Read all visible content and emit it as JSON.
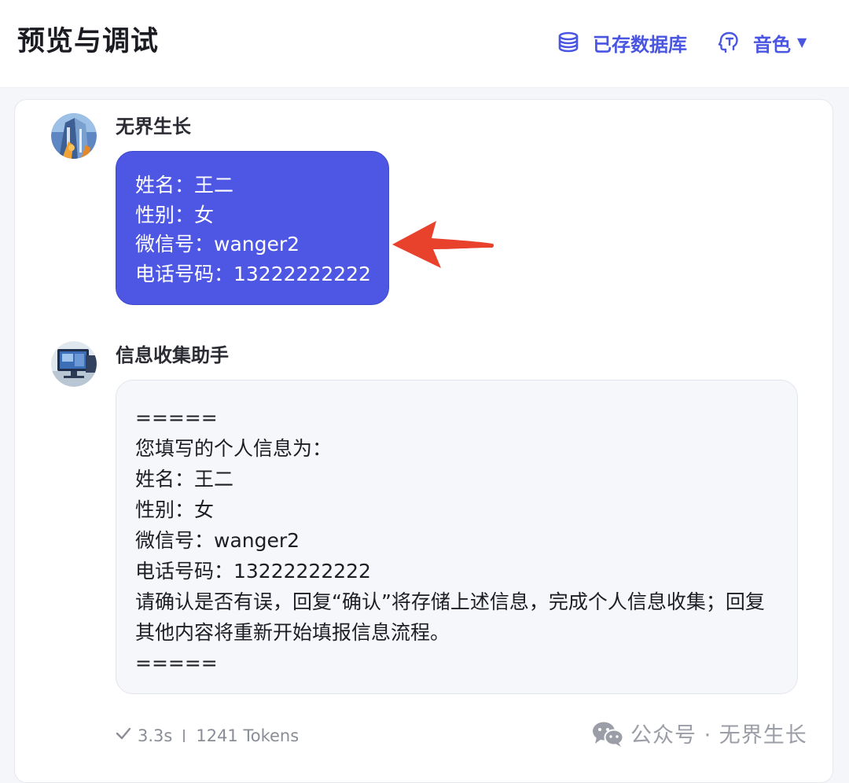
{
  "header": {
    "title": "预览与调试",
    "database_label": "已存数据库",
    "database_icon": "database-icon",
    "voice_label": "音色",
    "voice_icon": "voice-head-icon",
    "accent_color": "#4a56e2"
  },
  "messages": [
    {
      "sender": "无界生长",
      "role": "user",
      "lines": [
        "姓名：王二",
        "性别：女",
        "微信号：wanger2",
        "电话号码：13222222222"
      ]
    },
    {
      "sender": "信息收集助手",
      "role": "bot",
      "lines": [
        "=====",
        "您填写的个人信息为：",
        "姓名：王二",
        "性别：女",
        "微信号：wanger2",
        "电话号码：13222222222",
        "请确认是否有误，回复“确认”将存储上述信息，完成个人信息收集；回复其他内容将重新开始填报信息流程。",
        "====="
      ]
    }
  ],
  "meta": {
    "duration": "3.3s",
    "tokens": "1241 Tokens"
  },
  "watermark": {
    "text": "公众号 · 无界生长"
  },
  "colors": {
    "user_bubble": "#4d57e3",
    "bot_bubble": "#f6f7fa",
    "annotation_arrow": "#e8412c"
  }
}
